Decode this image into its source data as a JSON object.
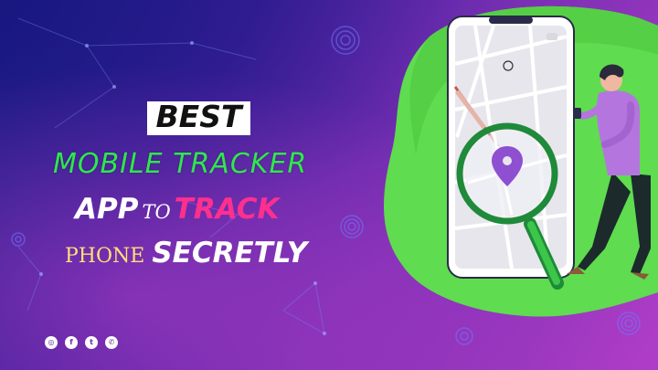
{
  "headline": {
    "best": "BEST",
    "line2": "MOBILE TRACKER",
    "line3_app": "APP",
    "line3_to": "TO",
    "line3_track": "TRACK",
    "line4_phone": "PHONE",
    "line4_secretly": "SECRETLY"
  },
  "social": {
    "icons": [
      "instagram-icon",
      "facebook-icon",
      "twitter-icon",
      "whatsapp-icon"
    ],
    "glyphs": [
      "◎",
      "f",
      "t",
      "✆"
    ]
  },
  "colors": {
    "background_start": "#1c1d8c",
    "background_end": "#b13dc7",
    "accent_green": "#2ee84c",
    "accent_pink": "#ff2f8e",
    "accent_yellow": "#ffe079",
    "map_pin": "#8e4fd0"
  }
}
